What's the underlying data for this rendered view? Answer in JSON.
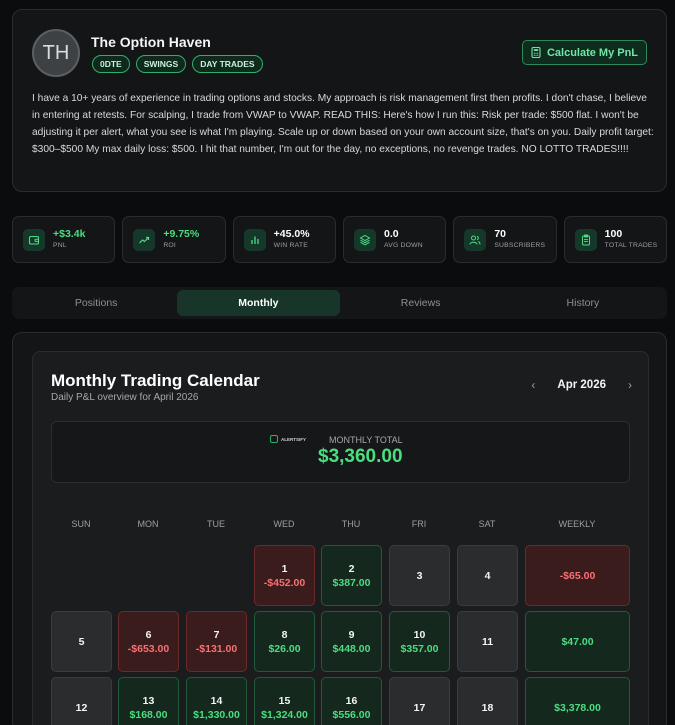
{
  "profile": {
    "initials": "TH",
    "name": "The Option Haven",
    "tags": [
      "0DTE",
      "SWINGS",
      "DAY TRADES"
    ],
    "calc_button": "Calculate My PnL",
    "bio": "I have a 10+ years of experience in trading options and stocks. My approach is risk management first then profits. I don't chase, I believe in entering at retests. For scalping, I trade from VWAP to VWAP. READ THIS: Here's how I run this: Risk per trade: $500 flat. I won't be adjusting it per alert, what you see is what I'm playing. Scale up or down based on your own account size, that's on you. Daily profit target: $300–$500 My max daily loss: $500. I hit that number, I'm out for the day, no exceptions, no revenge trades. NO LOTTO TRADES!!!!"
  },
  "stats": [
    {
      "value": "+$3.4k",
      "label": "PNL",
      "icon": "wallet-icon",
      "green": true
    },
    {
      "value": "+9.75%",
      "label": "ROI",
      "icon": "trending-up-icon",
      "green": true
    },
    {
      "value": "+45.0%",
      "label": "WIN RATE",
      "icon": "bar-chart-icon",
      "green": false
    },
    {
      "value": "0.0",
      "label": "AVG DOWN",
      "icon": "layers-icon",
      "green": false
    },
    {
      "value": "70",
      "label": "SUBSCRIBERS",
      "icon": "users-icon",
      "green": false
    },
    {
      "value": "100",
      "label": "TOTAL TRADES",
      "icon": "clipboard-icon",
      "green": false
    }
  ],
  "tabs": [
    "Positions",
    "Monthly",
    "Reviews",
    "History"
  ],
  "active_tab": "Monthly",
  "calendar": {
    "title": "Monthly Trading Calendar",
    "subtitle": "Daily P&L overview for April 2026",
    "month": "Apr 2026",
    "logo_text": "ALERTSIFY",
    "total_label": "MONTHLY TOTAL",
    "total_value": "$3,360.00",
    "headers": [
      "SUN",
      "MON",
      "TUE",
      "WED",
      "THU",
      "FRI",
      "SAT",
      "WEEKLY"
    ],
    "weeks": [
      {
        "days": [
          null,
          null,
          null,
          {
            "d": "1",
            "v": "-$452.00",
            "s": "neg"
          },
          {
            "d": "2",
            "v": "$387.00",
            "s": "pos"
          },
          {
            "d": "3",
            "v": "",
            "s": ""
          },
          {
            "d": "4",
            "v": "",
            "s": ""
          }
        ],
        "weekly": {
          "v": "-$65.00",
          "s": "neg"
        }
      },
      {
        "days": [
          {
            "d": "5",
            "v": "",
            "s": ""
          },
          {
            "d": "6",
            "v": "-$653.00",
            "s": "neg"
          },
          {
            "d": "7",
            "v": "-$131.00",
            "s": "neg"
          },
          {
            "d": "8",
            "v": "$26.00",
            "s": "pos"
          },
          {
            "d": "9",
            "v": "$448.00",
            "s": "pos"
          },
          {
            "d": "10",
            "v": "$357.00",
            "s": "pos"
          },
          {
            "d": "11",
            "v": "",
            "s": ""
          }
        ],
        "weekly": {
          "v": "$47.00",
          "s": "pos"
        }
      },
      {
        "days": [
          {
            "d": "12",
            "v": "",
            "s": ""
          },
          {
            "d": "13",
            "v": "$168.00",
            "s": "pos"
          },
          {
            "d": "14",
            "v": "$1,330.00",
            "s": "pos"
          },
          {
            "d": "15",
            "v": "$1,324.00",
            "s": "pos"
          },
          {
            "d": "16",
            "v": "$556.00",
            "s": "pos"
          },
          {
            "d": "17",
            "v": "",
            "s": ""
          },
          {
            "d": "18",
            "v": "",
            "s": ""
          }
        ],
        "weekly": {
          "v": "$3,378.00",
          "s": "pos"
        }
      }
    ]
  }
}
